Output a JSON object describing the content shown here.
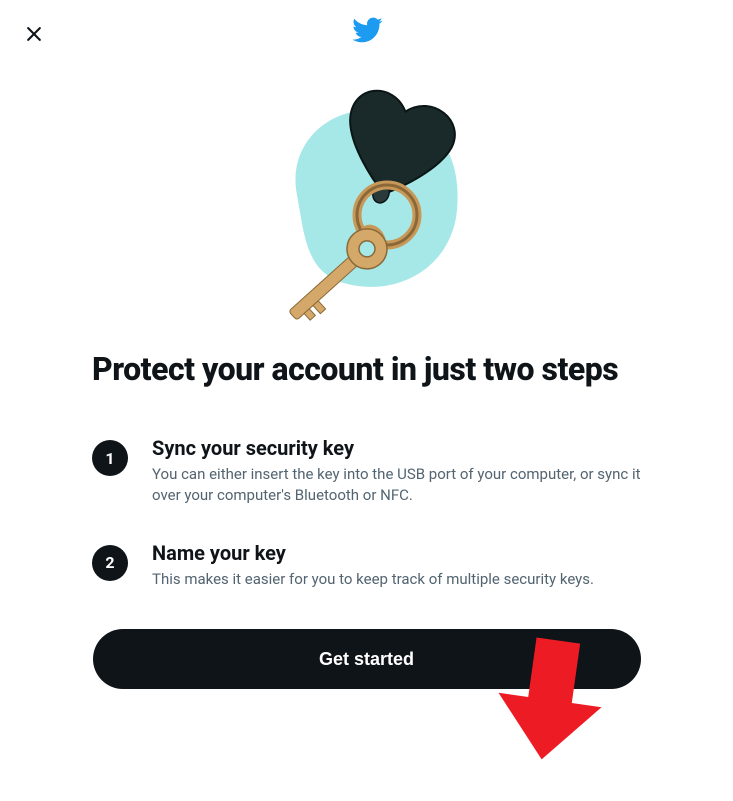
{
  "header": {
    "close_aria": "Close",
    "brand": "Twitter"
  },
  "illustration": {
    "alt": "Security key illustration with heart keychain"
  },
  "main": {
    "title": "Protect your account in just two steps",
    "steps": [
      {
        "number": "1",
        "title": "Sync your security key",
        "description": "You can either insert the key into the USB port of your computer, or sync it over your computer's Bluetooth or NFC."
      },
      {
        "number": "2",
        "title": "Name your key",
        "description": "This makes it easier for you to keep track of multiple security keys."
      }
    ],
    "cta_label": "Get started"
  },
  "annotation": {
    "arrow_color": "#ed1c24",
    "points_to": "get-started-button"
  },
  "colors": {
    "brand": "#1d9bf0",
    "text_primary": "#0f1419",
    "text_secondary": "#536471",
    "button_bg": "#0f1419"
  }
}
